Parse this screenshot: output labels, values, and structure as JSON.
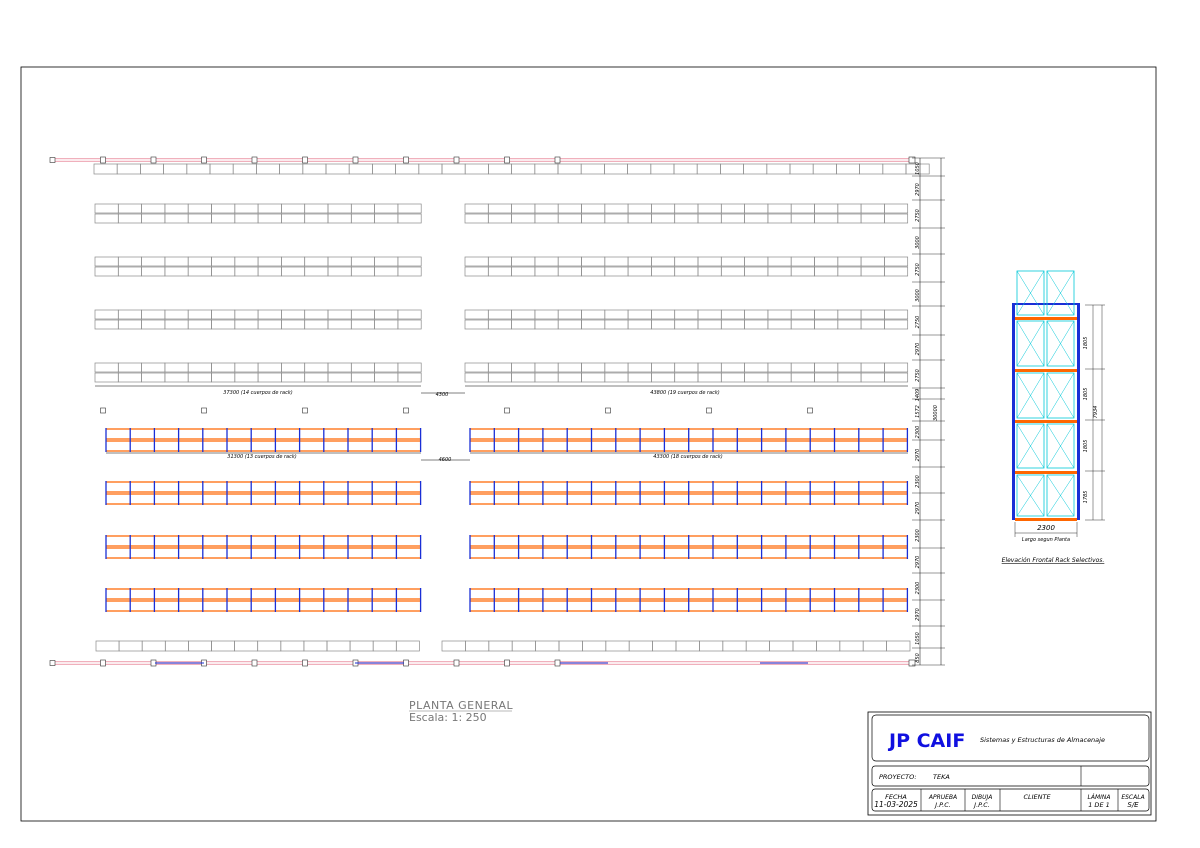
{
  "plan": {
    "title": "PLANTA GENERAL",
    "scale": "Escala: 1: 250",
    "upper_left_run": "37300 (14 cuerpos de rack)",
    "upper_gap": "4300",
    "upper_right_run": "43800 (19 cuerpos de rack)",
    "lower_left_run": "31300 (13 cuerpos de rack)",
    "lower_gap": "4600",
    "lower_right_run": "43300 (18 cuerpos de rack)",
    "overall_dim": "30000",
    "row_dims": [
      "1050",
      "2970",
      "2750",
      "3000",
      "2750",
      "3000",
      "2750",
      "2970",
      "2750",
      "1409",
      "1572",
      "2300",
      "2970",
      "2300",
      "2970",
      "2300",
      "2970",
      "2300",
      "2970",
      "1050",
      "850"
    ]
  },
  "elevation": {
    "title": "Elevación Frontal Rack Selectivos.",
    "levels": [
      "1805",
      "1805",
      "1805",
      "1785"
    ],
    "total_height": "7934",
    "width": "2300",
    "width_note": "Largo segun Planta"
  },
  "title_block": {
    "company": "JP CAIF",
    "tagline": "Sistemas y Estructuras de Almacenaje",
    "project_label": "PROYECTO:",
    "project_value": "TEKA",
    "fecha_label": "FECHA",
    "fecha_value": "11-03-2025",
    "aprueba_label": "APRUEBA",
    "aprueba_value": "J.P.C.",
    "dibuja_label": "DIBUJA",
    "dibuja_value": "J.P.C.",
    "cliente_label": "CLIENTE",
    "lamina_label": "LÁMINA",
    "lamina_value": "1 DE 1",
    "escala_label": "ESCALA",
    "escala_value": "S/E"
  },
  "colors": {
    "frame": "#000000",
    "gray_rack": "#8a8a8a",
    "orange_beam": "#ff6600",
    "blue_upright": "#1a2fd6",
    "pink_line": "#e0607a",
    "cyan_load": "#00c8d8",
    "brand_blue": "#1010e0"
  }
}
